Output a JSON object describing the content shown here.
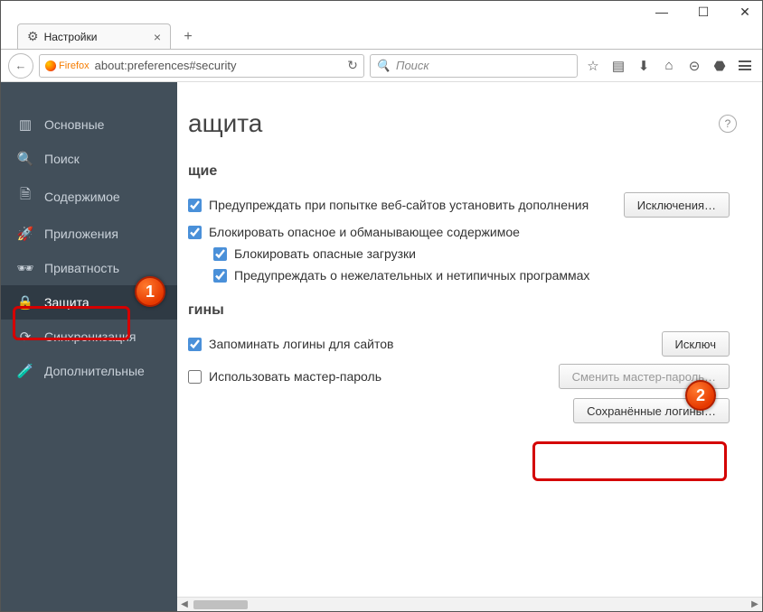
{
  "window": {
    "tab_title": "Настройки",
    "new_tab_tooltip": "+"
  },
  "urlbar": {
    "identity": "Firefox",
    "url": "about:preferences#security"
  },
  "searchbar": {
    "placeholder": "Поиск"
  },
  "sidebar": {
    "items": [
      {
        "icon": "▥",
        "label": "Основные"
      },
      {
        "icon": "🔍",
        "label": "Поиск"
      },
      {
        "icon": "🗎",
        "label": "Содержимое"
      },
      {
        "icon": "🚀",
        "label": "Приложения"
      },
      {
        "icon": "🕶",
        "label": "Приватность"
      },
      {
        "icon": "🔒",
        "label": "Защита"
      },
      {
        "icon": "⟳",
        "label": "Синхронизация"
      },
      {
        "icon": "🧪",
        "label": "Дополнительные"
      }
    ],
    "active_index": 5
  },
  "content": {
    "title_visible_fragment": "ащита",
    "section_general_fragment": "щие",
    "warn_addons": "Предупреждать при попытке веб-сайтов установить дополнения",
    "exceptions_btn": "Исключения…",
    "block_dangerous": "Блокировать опасное и обманывающее содержимое",
    "block_downloads": "Блокировать опасные загрузки",
    "warn_unwanted": "Предупреждать о нежелательных и нетипичных программах",
    "section_logins_fragment": "гины",
    "remember_logins": "Запоминать логины для сайтов",
    "exceptions2_visible": "Исключ",
    "use_master_pwd": "Использовать мастер-пароль",
    "change_master_btn": "Сменить мастер-пароль…",
    "saved_logins_btn": "Сохранённые логины…"
  },
  "annotations": {
    "one": "1",
    "two": "2"
  }
}
